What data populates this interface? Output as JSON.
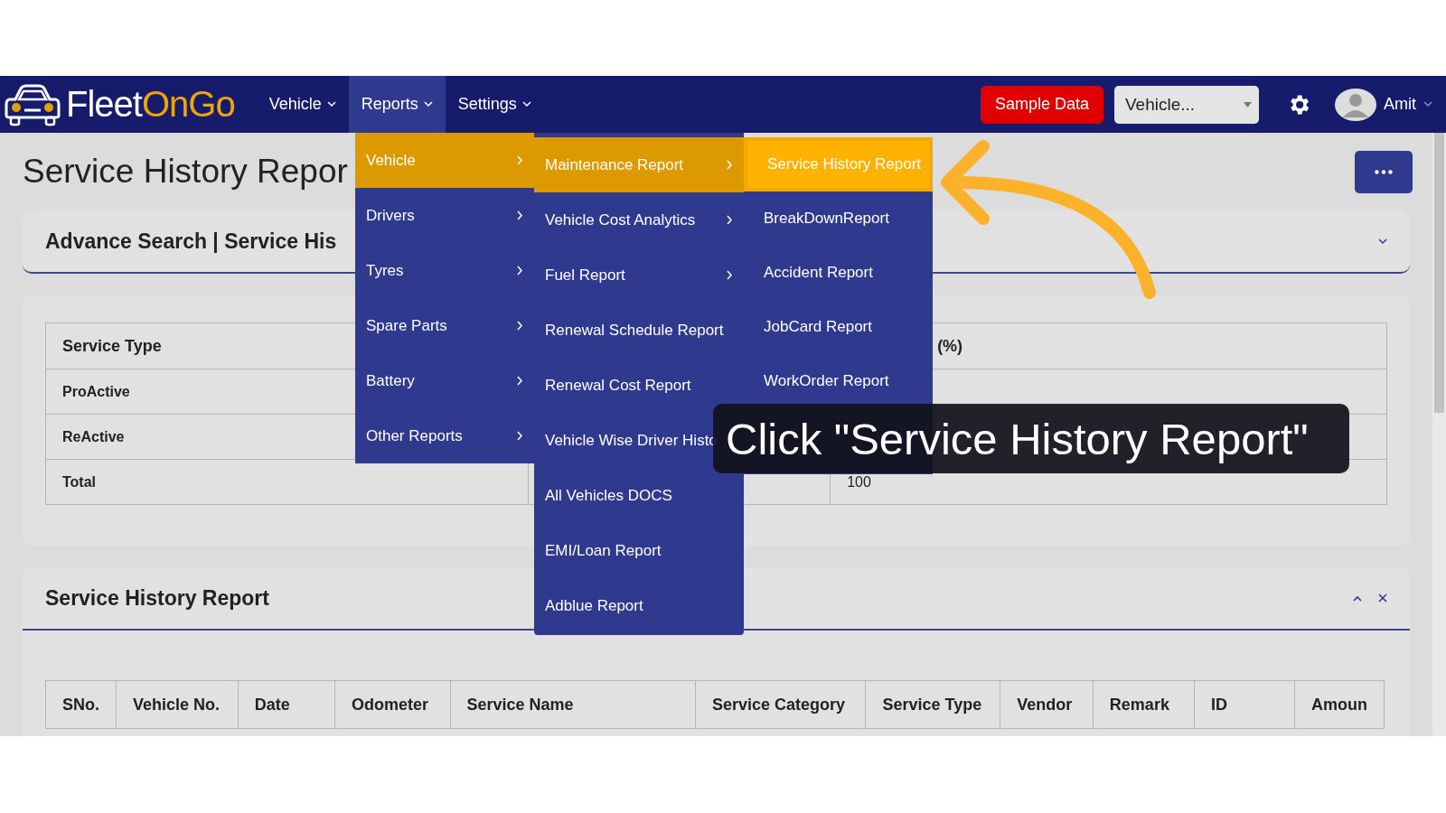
{
  "navbar": {
    "brand": {
      "part_1": "Fleet",
      "part_2": "OnGo"
    },
    "menus": [
      {
        "label": "Vehicle",
        "selected": false
      },
      {
        "label": "Reports",
        "selected": true
      },
      {
        "label": "Settings",
        "selected": false
      }
    ],
    "sample_button": "Sample Data",
    "vehicle_select": {
      "value": "Vehicle..."
    },
    "user": {
      "name": "Amit"
    }
  },
  "page": {
    "title": "Service History Repor",
    "advance_search": {
      "title": "Advance Search | Service His"
    },
    "summary_table": {
      "columns": [
        {
          "label": "Service Type"
        },
        {},
        {
          "label": "(%)"
        }
      ],
      "rows": [
        {
          "column_1": "ProActive"
        },
        {
          "column_1": "ReActive"
        },
        {
          "column_1": "Total",
          "column_3": "100"
        }
      ]
    },
    "report": {
      "title": "Service History Report",
      "columns": [
        "SNo.",
        "Vehicle No.",
        "Date",
        "Odometer",
        "Service Name",
        "Service Category",
        "Service Type",
        "Vendor",
        "Remark",
        "ID",
        "Amoun"
      ]
    }
  },
  "reports_menu": {
    "items": [
      {
        "label": "Vehicle",
        "selected": true,
        "has_submenu": true
      },
      {
        "label": "Drivers",
        "selected": false,
        "has_submenu": true
      },
      {
        "label": "Tyres",
        "selected": false,
        "has_submenu": true
      },
      {
        "label": "Spare Parts",
        "selected": false,
        "has_submenu": true
      },
      {
        "label": "Battery",
        "selected": false,
        "has_submenu": true
      },
      {
        "label": "Other Reports",
        "selected": false,
        "has_submenu": true
      }
    ]
  },
  "vehicle_menu": {
    "items": [
      {
        "label": "Maintenance Report",
        "selected": true,
        "has_submenu": true
      },
      {
        "label": "Vehicle Cost Analytics",
        "selected": false,
        "has_submenu": true
      },
      {
        "label": "Fuel Report",
        "selected": false,
        "has_submenu": true
      },
      {
        "label": "Renewal Schedule Report",
        "selected": false,
        "has_submenu": false
      },
      {
        "label": "Renewal Cost Report",
        "selected": false,
        "has_submenu": false
      },
      {
        "label": "Vehicle Wise Driver Histo",
        "selected": false,
        "has_submenu": false
      },
      {
        "label": "All Vehicles DOCS",
        "selected": false,
        "has_submenu": false
      },
      {
        "label": "EMI/Loan Report",
        "selected": false,
        "has_submenu": false
      },
      {
        "label": "Adblue Report",
        "selected": false,
        "has_submenu": false
      }
    ]
  },
  "maintenance_menu": {
    "items": [
      {
        "label": "Service History Report",
        "selected": true
      },
      {
        "label": "BreakDownReport",
        "selected": false
      },
      {
        "label": "Accident Report",
        "selected": false
      },
      {
        "label": "JobCard Report",
        "selected": false
      },
      {
        "label": "WorkOrder Report",
        "selected": false
      }
    ]
  },
  "tutorial_tooltip": {
    "text": "Click \"Service History Report\""
  }
}
